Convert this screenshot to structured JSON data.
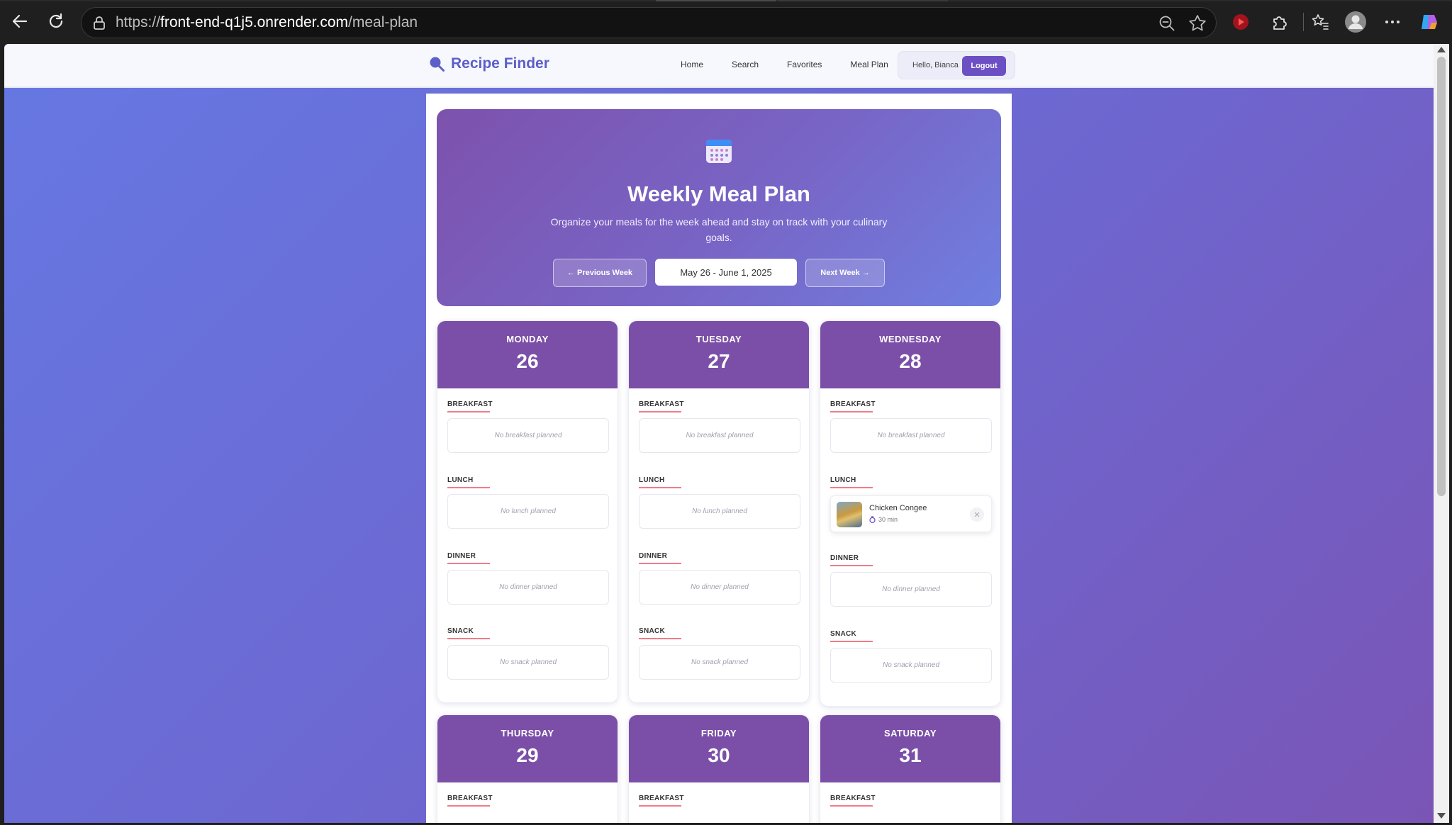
{
  "browser": {
    "url_prefix": "https://",
    "url_host": "front-end-q1j5.onrender.com",
    "url_path": "/meal-plan"
  },
  "app": {
    "brand": "Recipe Finder",
    "nav": [
      "Home",
      "Search",
      "Favorites",
      "Meal Plan"
    ],
    "greeting": "Hello, Bianca",
    "logout_label": "Logout"
  },
  "hero": {
    "title": "Weekly Meal Plan",
    "subtitle": "Organize your meals for the week ahead and stay on track with your culinary goals.",
    "prev_label": "← Previous Week",
    "range": "May 26 - June 1, 2025",
    "next_label": "Next Week →"
  },
  "meal_labels": {
    "breakfast": "BREAKFAST",
    "lunch": "LUNCH",
    "dinner": "DINNER",
    "snack": "SNACK"
  },
  "days": [
    {
      "name": "MONDAY",
      "num": "26",
      "breakfast": "No breakfast planned",
      "lunch": "No lunch planned",
      "dinner": "No dinner planned",
      "snack": "No snack planned"
    },
    {
      "name": "TUESDAY",
      "num": "27",
      "breakfast": "No breakfast planned",
      "lunch": "No lunch planned",
      "dinner": "No dinner planned",
      "snack": "No snack planned"
    },
    {
      "name": "WEDNESDAY",
      "num": "28",
      "breakfast": "No breakfast planned",
      "lunch_recipe": "Chicken Congee",
      "lunch_time": "30 min",
      "dinner": "No dinner planned",
      "snack": "No snack planned"
    },
    {
      "name": "THURSDAY",
      "num": "29"
    },
    {
      "name": "FRIDAY",
      "num": "30"
    },
    {
      "name": "SATURDAY",
      "num": "31"
    }
  ],
  "colors": {
    "accent": "#6d4fc4",
    "day_header": "#7b4fa8",
    "meal_underline": "#f07c8a"
  }
}
